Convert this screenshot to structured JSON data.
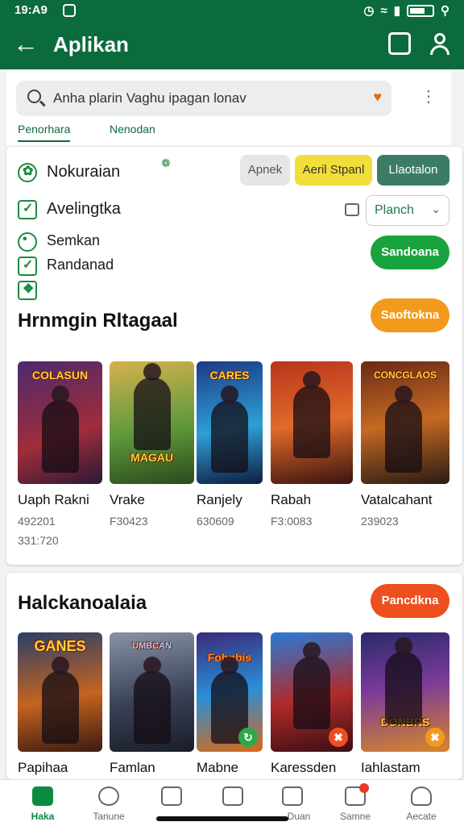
{
  "status": {
    "time": "19:A9"
  },
  "appbar": {
    "title": "Aplikan"
  },
  "search": {
    "text": "Anha plarin Vaghu ipagan lonav"
  },
  "tabs": [
    {
      "label": "Penorhara"
    },
    {
      "label": "Nenodan"
    }
  ],
  "filters": {
    "rows": [
      {
        "label": "Nokuraian"
      },
      {
        "label": "Avelingtka"
      },
      {
        "label": "Semkan"
      },
      {
        "label": "Randanad"
      }
    ],
    "pills": [
      {
        "label": "Apnek"
      },
      {
        "label": "Aeril Stpanl"
      },
      {
        "label": "Llaotalon"
      }
    ],
    "select_value": "Planch",
    "green_button": "Sandoana",
    "orange_button": "Saoftokna"
  },
  "section1": {
    "title": "Hrnmgin Rltagaal",
    "games": [
      {
        "name": "Uaph Rakni",
        "line1": "492201",
        "line2": "331:720",
        "logo": "COLASUN"
      },
      {
        "name": "Vrake",
        "line1": "F30423",
        "line2": "",
        "logo": "MAGAU"
      },
      {
        "name": "Ranjely",
        "line1": "630609",
        "line2": "",
        "logo": "CARES"
      },
      {
        "name": "Rabah",
        "line1": "F3:0083",
        "line2": "",
        "logo": ""
      },
      {
        "name": "Vatalcahant",
        "line1": "239023",
        "line2": "",
        "logo": "CONCGLAOS"
      }
    ]
  },
  "section2": {
    "title": "Halckanoalaia",
    "button": "Pancdkna",
    "games": [
      {
        "name": "Papihaa",
        "logo": "GANES"
      },
      {
        "name": "Famlan",
        "logo": "UMBCAN"
      },
      {
        "name": "Mabne",
        "logo": "Fohnbis"
      },
      {
        "name": "Karessden",
        "logo": ""
      },
      {
        "name": "Iahlastam",
        "logo": "DONBRS"
      }
    ]
  },
  "nav": [
    {
      "label": "Haka"
    },
    {
      "label": "Tanune"
    },
    {
      "label": ""
    },
    {
      "label": ""
    },
    {
      "label": "Duan"
    },
    {
      "label": "Samne"
    },
    {
      "label": "Aecate"
    }
  ],
  "colors": {
    "primary": "#0c6b3d",
    "accent_green": "#18a33e",
    "accent_orange": "#f39a1c",
    "accent_red": "#ee4f1e",
    "yellow": "#f2de3b"
  }
}
